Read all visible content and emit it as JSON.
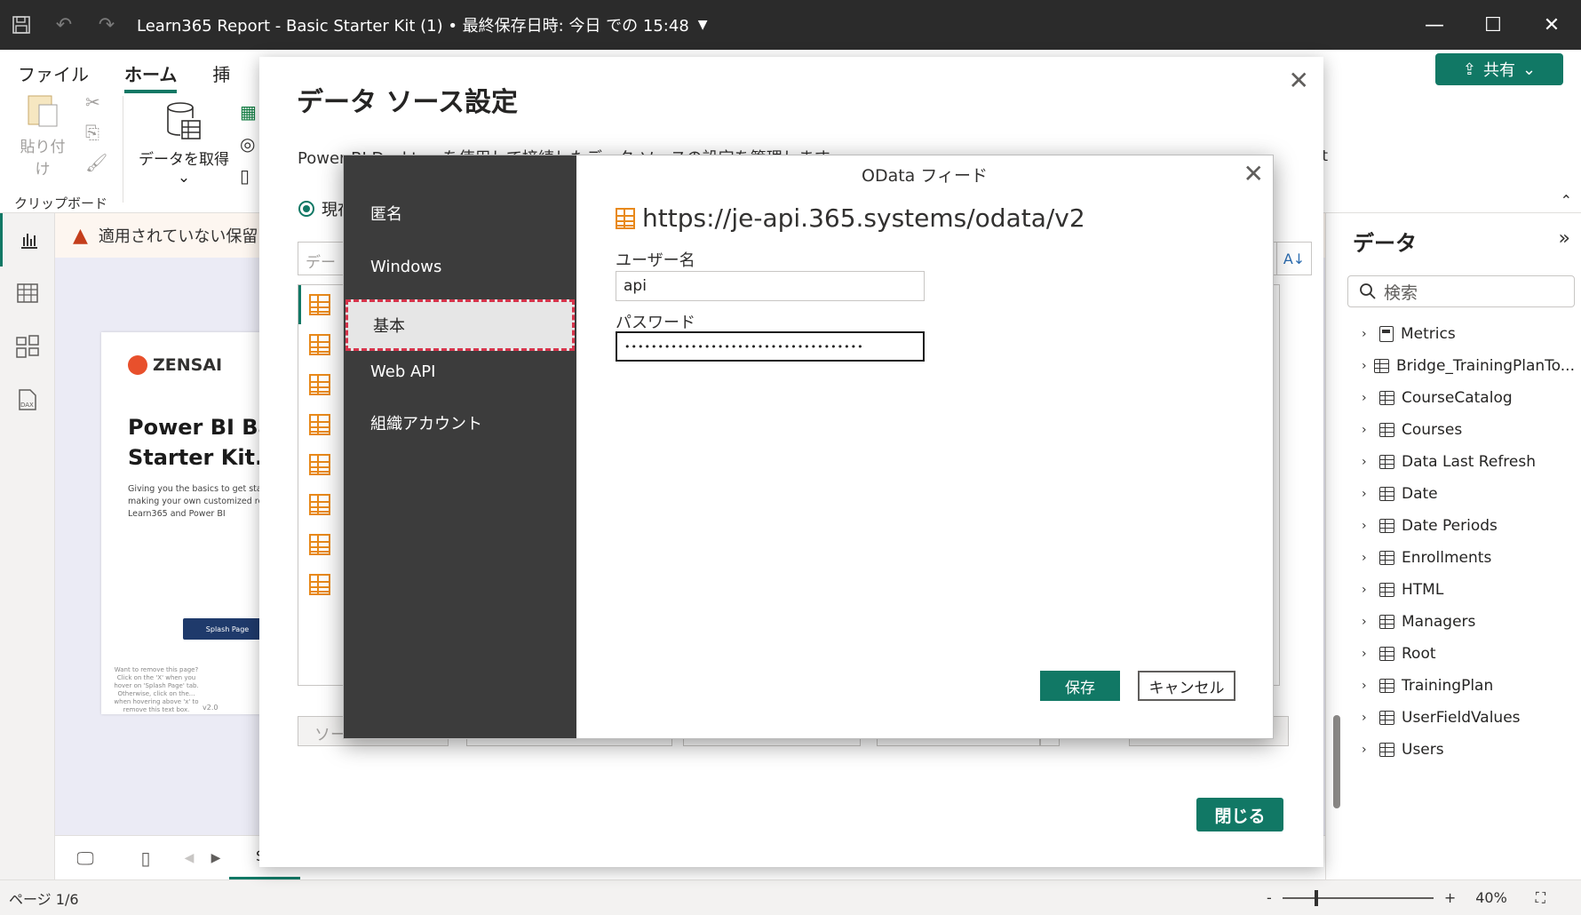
{
  "titlebar": {
    "title": "Learn365 Report - Basic Starter Kit (1) • 最終保存日時: 今日 での 15:48"
  },
  "ribbon": {
    "tabs": [
      "ファイル",
      "ホーム",
      "挿"
    ],
    "share_label": "共有",
    "paste_label": "貼り付け",
    "get_data_label": "データを取得",
    "clipboard_label": "クリップボード",
    "cut_off_label": "ot"
  },
  "warning": {
    "text": "適用されていない保留"
  },
  "report_page": {
    "logo_text": "ZENSAI",
    "title_line1": "Power BI Bas",
    "title_line2": "Starter Kit.",
    "description": "Giving you the basics to get sta making your own customized re with Learn365 and Power BI",
    "splash_button": "Splash Page",
    "note": "Want to remove this page? Click on the 'X' when you hover on 'Splash Page' tab. Otherwise, click on the... when hovering above 'x' to remove this text box.",
    "version": "v2.0"
  },
  "page_tabs": {
    "current_tab": "Sp"
  },
  "statusbar": {
    "page_indicator": "ページ 1/6",
    "zoom_minus": "-",
    "zoom_plus": "+",
    "zoom_value": "40%"
  },
  "data_pane": {
    "title": "データ",
    "search_placeholder": "検索",
    "items": [
      {
        "label": "Metrics",
        "icon": "calculator-icon"
      },
      {
        "label": "Bridge_TrainingPlanTo...",
        "icon": "table-icon"
      },
      {
        "label": "CourseCatalog",
        "icon": "table-icon"
      },
      {
        "label": "Courses",
        "icon": "table-icon"
      },
      {
        "label": "Data Last Refresh",
        "icon": "table-icon"
      },
      {
        "label": "Date",
        "icon": "table-icon"
      },
      {
        "label": "Date Periods",
        "icon": "calculated-table-icon"
      },
      {
        "label": "Enrollments",
        "icon": "table-icon"
      },
      {
        "label": "HTML",
        "icon": "table-icon"
      },
      {
        "label": "Managers",
        "icon": "table-icon"
      },
      {
        "label": "Root",
        "icon": "table-icon"
      },
      {
        "label": "TrainingPlan",
        "icon": "table-icon"
      },
      {
        "label": "UserFieldValues",
        "icon": "table-icon"
      },
      {
        "label": "Users",
        "icon": "table-icon"
      }
    ]
  },
  "datasource_dialog": {
    "title": "データ ソース設定",
    "description": "Power BI Desktop を使用して接続したデータ ソースの設定を管理します。",
    "radio_label": "現在",
    "search_placeholder": "デー",
    "bottom_label": "ソー",
    "close_button": "閉じる"
  },
  "odata_dialog": {
    "title": "OData フィード",
    "url": "https://je-api.365.systems/odata/v2",
    "auth_methods": [
      "匿名",
      "Windows",
      "基本",
      "Web API",
      "組織アカウント"
    ],
    "selected_auth": "基本",
    "username_label": "ユーザー名",
    "username_value": "api",
    "password_label": "パスワード",
    "password_value": "••••••••••••••••••••••••••••••••••••",
    "save_button": "保存",
    "cancel_button": "キャンセル"
  },
  "colors": {
    "accent": "#117865",
    "warning": "#c43e1c",
    "odata_icon": "#e8891a",
    "selection_border": "#d6344b"
  }
}
